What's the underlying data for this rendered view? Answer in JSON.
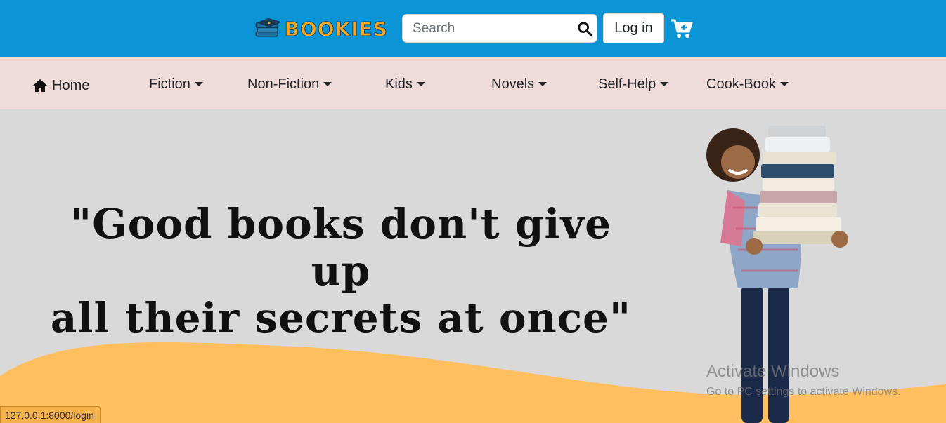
{
  "header": {
    "logo_text": "BOOKIES",
    "search_placeholder": "Search",
    "login_label": "Log in",
    "icons": [
      "books-logo-icon",
      "search-icon",
      "cart-plus-icon"
    ],
    "colors": {
      "bar": "#0b95d6",
      "logo": "#f5a623"
    }
  },
  "nav": {
    "items": [
      {
        "label": "Home",
        "icon": "home-icon",
        "dropdown": false
      },
      {
        "label": "Fiction",
        "dropdown": true
      },
      {
        "label": "Non-Fiction",
        "dropdown": true
      },
      {
        "label": "Kids",
        "dropdown": true
      },
      {
        "label": "Novels",
        "dropdown": true
      },
      {
        "label": "Self-Help",
        "dropdown": true
      },
      {
        "label": "Cook-Book",
        "dropdown": true
      }
    ],
    "colors": {
      "bar": "#efdcd9"
    }
  },
  "hero": {
    "quote_line1": "\"Good books don't give up",
    "quote_line2": "all their secrets at once\"",
    "colors": {
      "background": "#d9d9d9",
      "wave": "#ffbf5e"
    }
  },
  "watermark": {
    "title": "Activate Windows",
    "subtitle": "Go to PC settings to activate Windows."
  },
  "status_bar": {
    "url": "127.0.0.1:8000/login"
  }
}
